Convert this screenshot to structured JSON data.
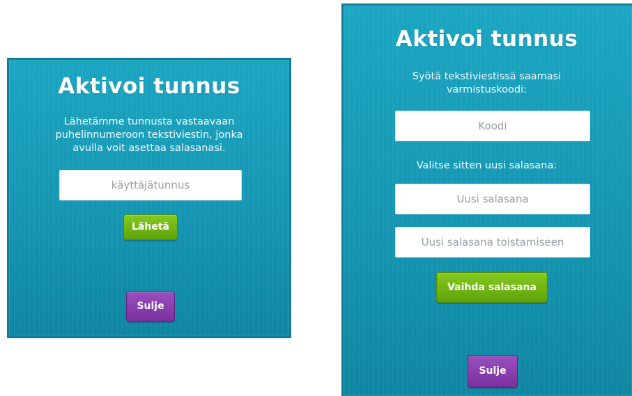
{
  "left_dialog": {
    "title": "Aktivoi tunnus",
    "description": [
      "Lähetämme tunnusta vastaavaan",
      "puhelinnumeroon tekstiviestin, jonka",
      "avulla voit asettaa salasanasi."
    ],
    "username_placeholder": "käyttäjätunnus",
    "send_label": "Lähetä",
    "close_label": "Sulje"
  },
  "right_dialog": {
    "title": "Aktivoi tunnus",
    "code_instruction": [
      "Syötä tekstiviestissä saamasi",
      "varmistuskoodi:"
    ],
    "code_placeholder": "Koodi",
    "password_instruction": "Valitse sitten uusi salasana:",
    "new_password_placeholder": "Uusi salasana",
    "repeat_password_placeholder": "Uusi salasana toistamiseen",
    "change_label": "Vaihda salasana",
    "close_label": "Sulje"
  },
  "colors": {
    "panel": "#1596b2",
    "panel_border": "#137d95",
    "button_green": "#6fb512",
    "button_purple": "#8a3fae",
    "placeholder_text": "#9aa0a3"
  }
}
